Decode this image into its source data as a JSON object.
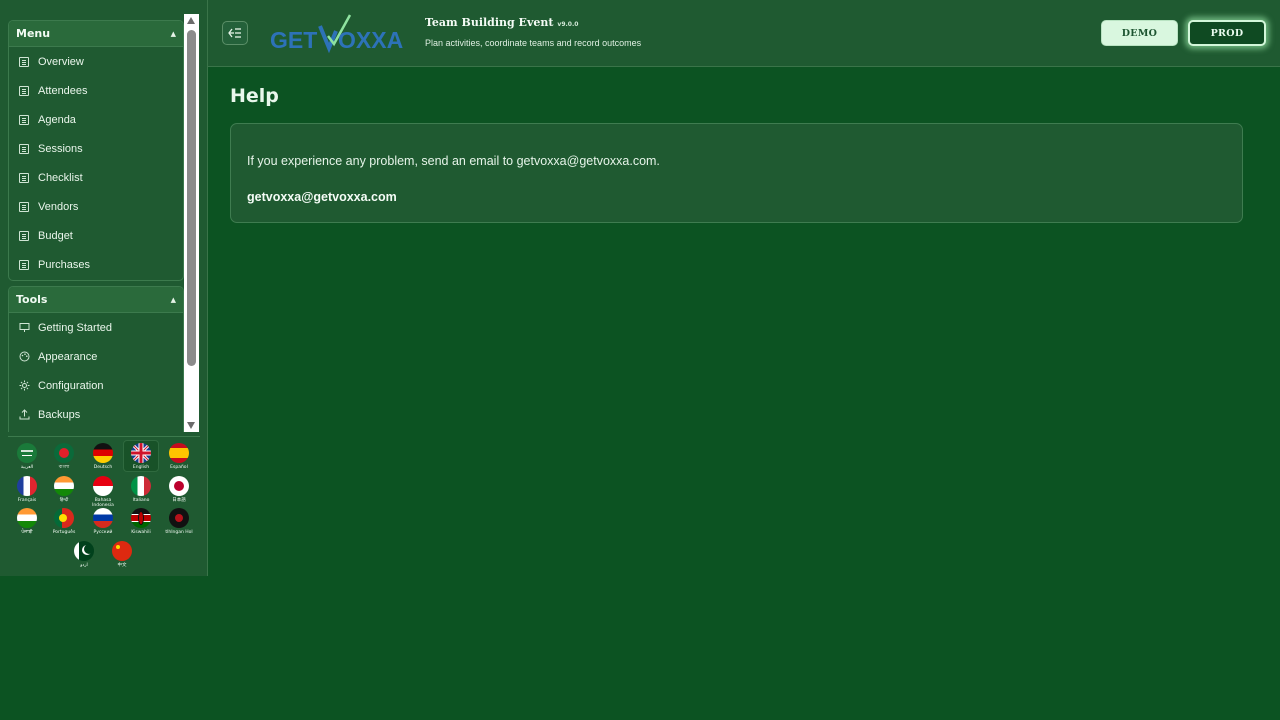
{
  "sidebar": {
    "menu": {
      "title": "Menu",
      "items": [
        {
          "label": "Overview"
        },
        {
          "label": "Attendees"
        },
        {
          "label": "Agenda"
        },
        {
          "label": "Sessions"
        },
        {
          "label": "Checklist"
        },
        {
          "label": "Vendors"
        },
        {
          "label": "Budget"
        },
        {
          "label": "Purchases"
        }
      ]
    },
    "tools": {
      "title": "Tools",
      "items": [
        {
          "label": "Getting Started",
          "icon": "presentation-icon"
        },
        {
          "label": "Appearance",
          "icon": "palette-icon"
        },
        {
          "label": "Configuration",
          "icon": "gear-icon"
        },
        {
          "label": "Backups",
          "icon": "upload-icon"
        }
      ]
    },
    "languages": [
      {
        "label": "العربية"
      },
      {
        "label": "বাংলা"
      },
      {
        "label": "Deutsch"
      },
      {
        "label": "English",
        "active": true
      },
      {
        "label": "Español"
      },
      {
        "label": "Français"
      },
      {
        "label": "हिन्दी"
      },
      {
        "label": "Bahasa Indonesia"
      },
      {
        "label": "Italiano"
      },
      {
        "label": "日本語"
      },
      {
        "label": "ਪੰਜਾਬੀ"
      },
      {
        "label": "Português"
      },
      {
        "label": "Русский"
      },
      {
        "label": "Kiswahili"
      },
      {
        "label": "tlhIngan Hol"
      },
      {
        "label": "اردو"
      },
      {
        "label": "中文"
      }
    ]
  },
  "header": {
    "logo_text": "GETVOXXA",
    "title": "Team Building Event",
    "version": "v9.0.0",
    "subtitle": "Plan activities, coordinate teams and record outcomes",
    "demo_label": "DEMO",
    "prod_label": "PROD"
  },
  "main": {
    "title": "Help",
    "help_text": "If you experience any problem, send an email to getvoxxa@getvoxxa.com.",
    "help_email": "getvoxxa@getvoxxa.com"
  },
  "colors": {
    "background": "#0c5322",
    "panel": "#1f5a31",
    "accent_glow": "#a0f0af"
  }
}
